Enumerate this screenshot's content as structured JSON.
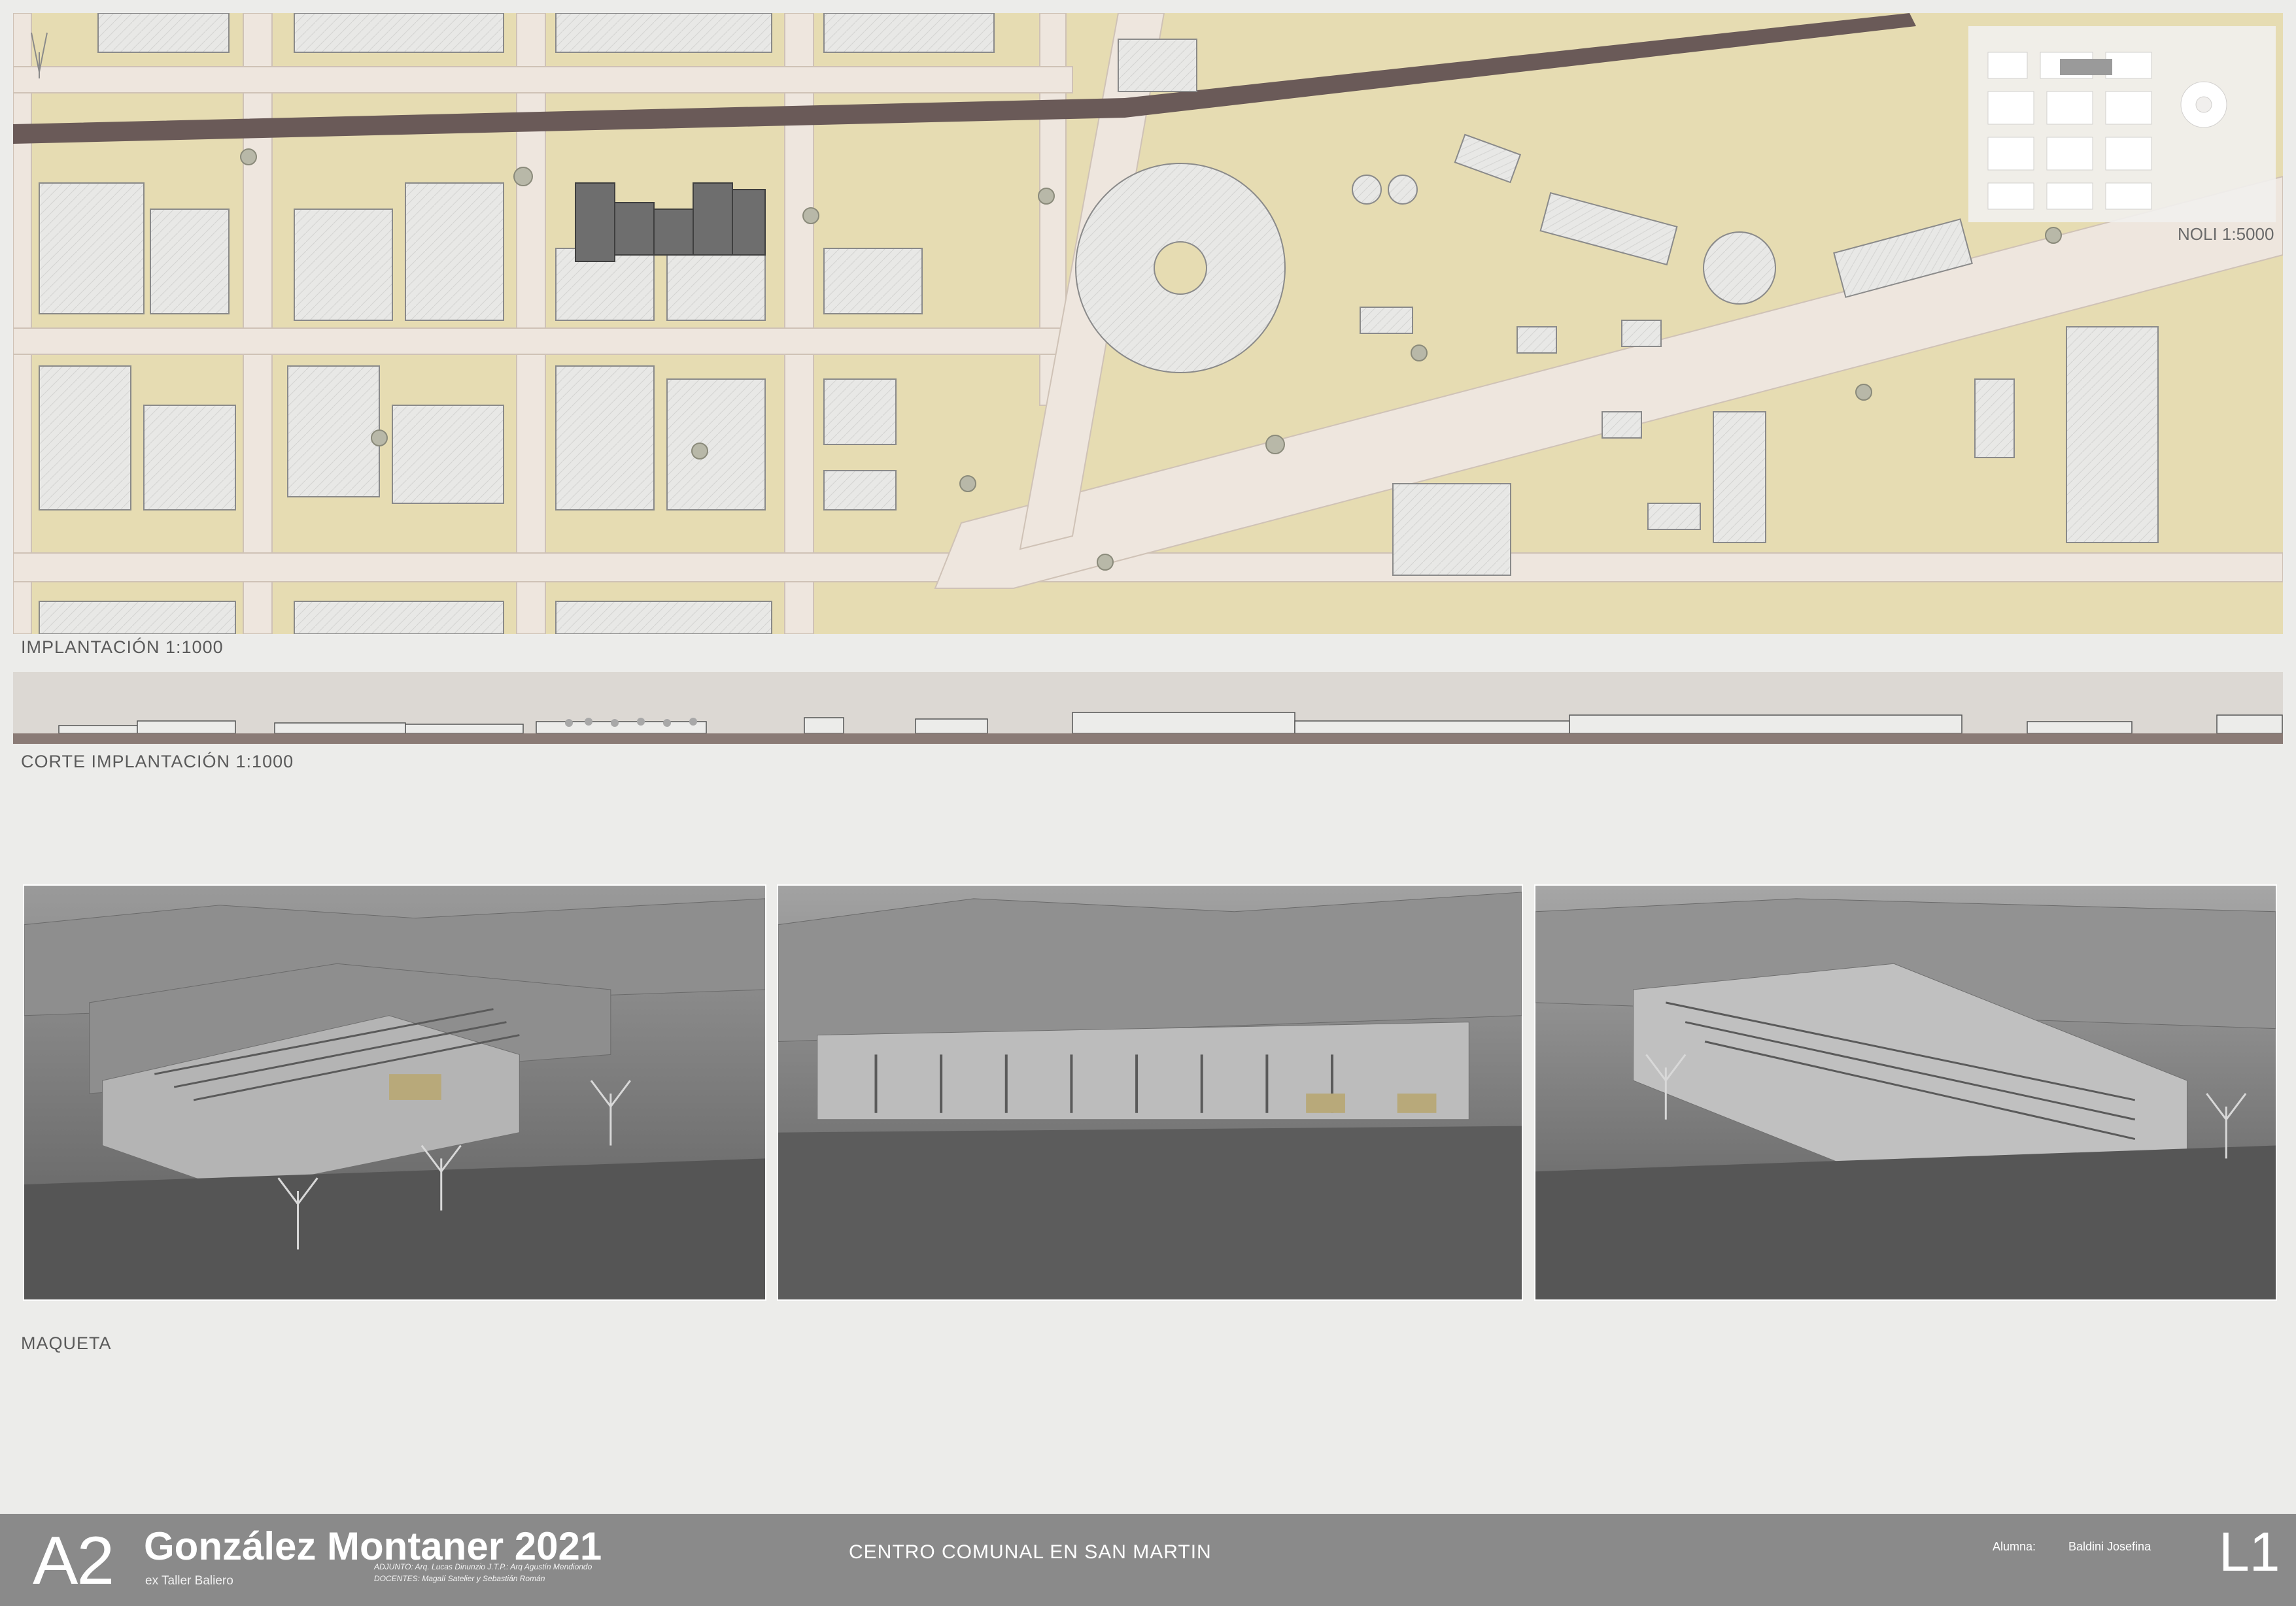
{
  "site_plan": {
    "label": "IMPLANTACIÓN 1:1000",
    "inset_label": "NOLI 1:5000",
    "colors": {
      "block": "#e6dcb2",
      "street": "#eee6de",
      "building": "#e7e7e5",
      "project": "#6e6e6e"
    }
  },
  "section": {
    "label": "CORTE IMPLANTACIÓN 1:1000"
  },
  "model": {
    "label": "MAQUETA",
    "photos": [
      "model-view-1",
      "model-view-2",
      "model-view-3"
    ]
  },
  "title_block": {
    "sheet_code": "A2",
    "course_title": "González Montaner 2021",
    "workshop": "ex Taller Baliero",
    "adjunct": "ADJUNTO: Arq. Lucas Dinunzio J.T.P.: Arq Agustín Mendiondo",
    "teachers": "DOCENTES: Magalí Satelier y Sebastián Román",
    "project_title": "CENTRO COMUNAL EN SAN MARTIN",
    "student_label": "Alumna:",
    "student_name": "Baldini Josefina",
    "sheet_number": "L1"
  }
}
